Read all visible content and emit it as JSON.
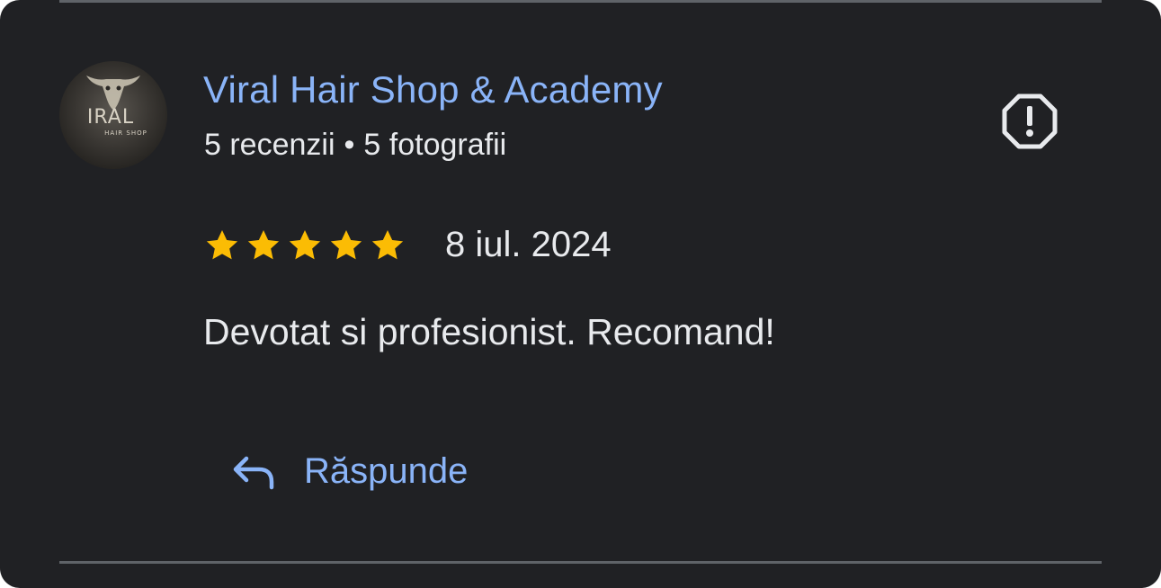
{
  "review": {
    "author": {
      "name": "Viral Hair Shop & Academy",
      "reviews_count": "5 recenzii",
      "separator": "•",
      "photos_count": "5 fotografii",
      "avatar_icon": "viral-hair-shop-logo",
      "avatar_text_big": "IRAL",
      "avatar_text_small": "HAIR SHOP"
    },
    "report_icon": "report-flag-octagon-icon",
    "rating": {
      "value": 5,
      "max": 5,
      "star_color": "#fbbc04"
    },
    "date": "8 iul. 2024",
    "text": "Devotat si profesionist. Recomand!",
    "reply": {
      "icon": "reply-arrow-icon",
      "label": "Răspunde"
    }
  },
  "colors": {
    "background": "#202124",
    "link": "#8ab4f8",
    "text": "#e8eaed",
    "divider": "#5f6368"
  }
}
